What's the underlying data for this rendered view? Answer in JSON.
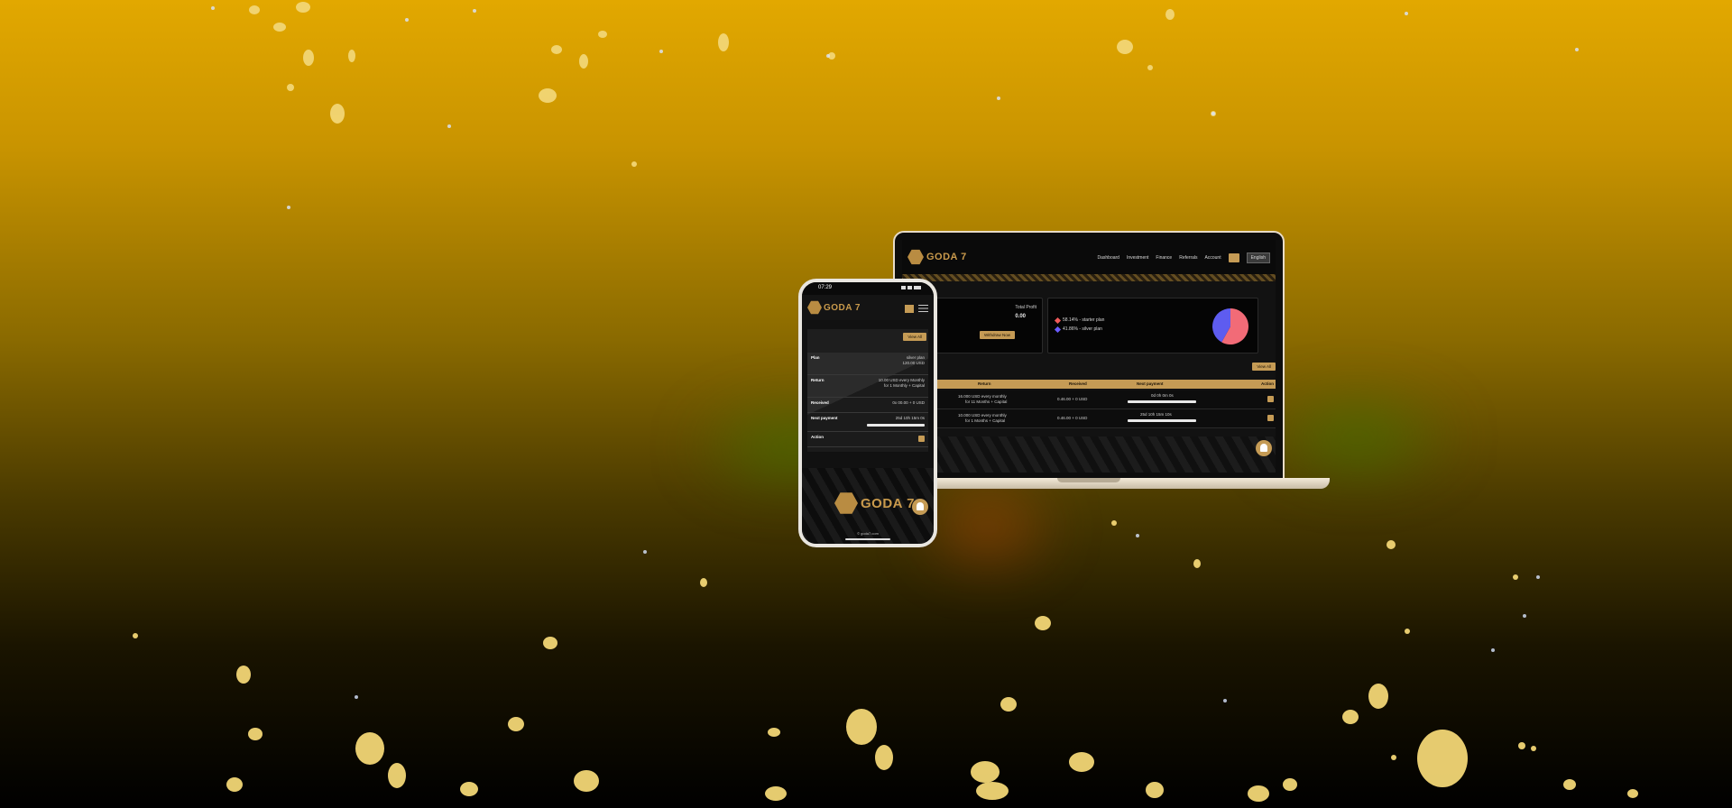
{
  "brand": {
    "logo_text": "GODA 7"
  },
  "laptop": {
    "nav": {
      "items": [
        "Dashboard",
        "Investment",
        "Finance",
        "Referrals",
        "Account"
      ],
      "language": "English"
    },
    "stats": {
      "total_profit_label": "Total Profit",
      "total_profit_value": "0.00",
      "withdraw_button": "Withdraw Now",
      "deposit_button": "ate"
    },
    "plans_legend": [
      {
        "label": "58.14% - starter plan",
        "color": "#f05a5a"
      },
      {
        "label": "41.86% - silver plan",
        "color": "#6a5cff"
      }
    ],
    "pie": {
      "values": [
        58.14,
        41.86
      ],
      "colors": [
        "#f26b77",
        "#5e5cf0"
      ]
    },
    "view_all": "View All",
    "table": {
      "headers": [
        "Return",
        "Received",
        "Next payment",
        "Action"
      ],
      "rows": [
        {
          "return": "16.000 USD every monthly",
          "return2": "for 11 Months + Capital",
          "received": "0.46.00 + 0 USD",
          "next": "0d 0h 0m 0s"
        },
        {
          "return": "10.000 USD every monthly",
          "return2": "for 1 Months + Capital",
          "received": "0.46.00 + 0 USD",
          "next": "25d 10h 15m 10s"
        }
      ]
    }
  },
  "phone": {
    "time": "07:29",
    "view_all": "View All",
    "rows": [
      {
        "key": "Plan",
        "value": "silver plan",
        "value2": "120.00 USD"
      },
      {
        "key": "Return",
        "value": "10.00 USD every Monthly",
        "value2": "for 1 Monthly + Capital"
      },
      {
        "key": "Received",
        "value": "0x 00.00 + 0 USD",
        "value2": ""
      },
      {
        "key": "Next payment",
        "value": "25d 10h 15m 0s",
        "value2": ""
      },
      {
        "key": "Action",
        "value": "",
        "value2": ""
      }
    ],
    "footer_copy": "© goda7.com"
  }
}
